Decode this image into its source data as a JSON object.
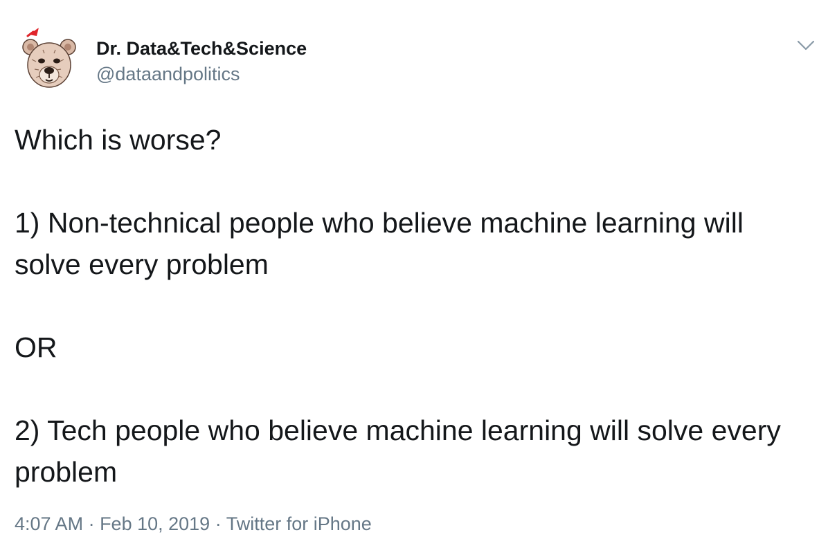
{
  "author": {
    "display_name": "Dr. Data&Tech&Science",
    "handle": "@dataandpolitics",
    "avatar_icon": "bear-avatar-icon"
  },
  "menu": {
    "icon": "chevron-down-icon"
  },
  "tweet": {
    "text": "Which is worse?\n\n1) Non-technical people who believe machine learning will solve every problem\n\nOR\n\n2) Tech people who believe machine learning will solve every problem"
  },
  "meta": {
    "time": "4:07 AM",
    "separator_1": " · ",
    "date": "Feb 10, 2019",
    "separator_2": " · ",
    "source": "Twitter for iPhone"
  },
  "colors": {
    "text_primary": "#14171a",
    "text_secondary": "#657786",
    "santa_hat_red": "#e0242a"
  }
}
